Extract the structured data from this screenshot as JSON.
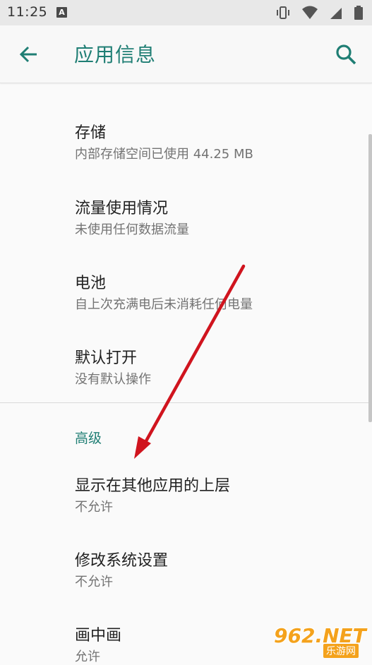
{
  "status_bar": {
    "time": "11:25",
    "notification_badge": "A",
    "icons": [
      "vibrate-icon",
      "wifi-icon",
      "signal-icon",
      "battery-icon"
    ]
  },
  "app_bar": {
    "title": "应用信息",
    "back_icon": "arrow-left-icon",
    "search_icon": "search-icon"
  },
  "items": [
    {
      "title": "存储",
      "subtitle": "内部存储空间已使用 44.25 MB"
    },
    {
      "title": "流量使用情况",
      "subtitle": "未使用任何数据流量"
    },
    {
      "title": "电池",
      "subtitle": "自上次充满电后未消耗任何电量"
    },
    {
      "title": "默认打开",
      "subtitle": "没有默认操作"
    }
  ],
  "advanced": {
    "header": "高级",
    "items": [
      {
        "title": "显示在其他应用的上层",
        "subtitle": "不允许"
      },
      {
        "title": "修改系统设置",
        "subtitle": "不允许"
      },
      {
        "title": "画中画",
        "subtitle": "允许"
      }
    ]
  },
  "colors": {
    "accent": "#1f7e74",
    "annotation_arrow": "#d0141e"
  },
  "watermark": {
    "logo": "962.NET",
    "tagline": "乐游网"
  }
}
